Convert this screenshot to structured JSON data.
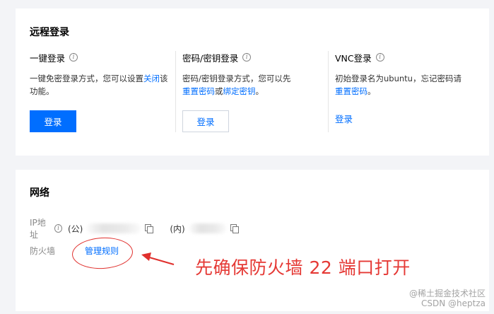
{
  "remote_login": {
    "title": "远程登录",
    "one_click": {
      "heading": "一键登录",
      "desc_before": "一键免密登录方式，您可以设置",
      "desc_link": "关闭",
      "desc_after": "该功能。",
      "button": "登录"
    },
    "password": {
      "heading": "密码/密钥登录",
      "desc_before": "密码/密钥登录方式，您可以先",
      "link_reset": "重置密码",
      "desc_or": "或",
      "link_bind": "绑定密钥",
      "desc_end": "。",
      "button": "登录"
    },
    "vnc": {
      "heading": "VNC登录",
      "desc_before": "初始登录名为ubuntu，忘记密码请",
      "link_reset": "重置密码",
      "desc_end": "。",
      "button": "登录"
    }
  },
  "network": {
    "title": "网络",
    "ip_label": "IP地址",
    "public_label": "(公)",
    "private_label": "(内)",
    "firewall_label": "防火墙",
    "firewall_link": "管理规则"
  },
  "annotation": {
    "text": "先确保防火墙 22 端口打开",
    "color": "#e53935"
  },
  "watermark": {
    "line1": "@稀土掘金技术社区",
    "line2": "CSDN @heptza"
  },
  "colors": {
    "accent": "#006eff",
    "background": "#f3f4f7",
    "annotation": "#e53935"
  }
}
